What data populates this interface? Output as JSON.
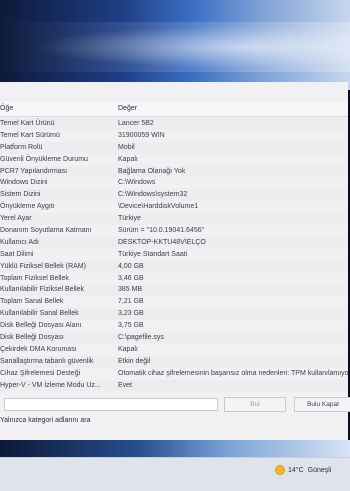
{
  "table": {
    "headers": {
      "item": "Öğe",
      "value": "Değer"
    },
    "rows": [
      {
        "k": "Temel Kart Ürünü",
        "v": "Lancer 5B2"
      },
      {
        "k": "Temel Kart Sürümü",
        "v": "31900059 WIN"
      },
      {
        "k": "Platform Rolü",
        "v": "Mobil"
      },
      {
        "k": "Güvenli Önyükleme Durumu",
        "v": "Kapalı"
      },
      {
        "k": "PCR7 Yapılandırması",
        "v": "Bağlama Olanağı Yok"
      },
      {
        "k": "Windows Dizini",
        "v": "C:\\Windows"
      },
      {
        "k": "Sistem Dizini",
        "v": "C:\\Windows\\system32"
      },
      {
        "k": "Önyükleme Aygıtı",
        "v": "\\Device\\HarddiskVolume1"
      },
      {
        "k": "Yerel Ayar",
        "v": "Türkiye"
      },
      {
        "k": "Donanım Soyutlama Katmanı",
        "v": "Sürüm = \"10.0.19041.6456\""
      },
      {
        "k": "Kullanıcı Adı",
        "v": "DESKTOP-KKTU48V\\ELÇO"
      },
      {
        "k": "Saat Dilimi",
        "v": "Türkiye Standart Saati"
      },
      {
        "k": "Yüklü Fiziksel Bellek (RAM)",
        "v": "4,00 GB"
      },
      {
        "k": "Toplam Fiziksel Bellek",
        "v": "3,46 GB"
      },
      {
        "k": "Kullanılabilir Fiziksel Bellek",
        "v": "385 MB"
      },
      {
        "k": "Toplam Sanal Bellek",
        "v": "7,21 GB"
      },
      {
        "k": "Kullanılabilir Sanal Bellek",
        "v": "3,23 GB"
      },
      {
        "k": "Disk Belleği Dosyası Alanı",
        "v": "3,75 GB"
      },
      {
        "k": "Disk Belleği Dosyası",
        "v": "C:\\pagefile.sys"
      },
      {
        "k": "Çekirdek DMA Koruması",
        "v": "Kapalı"
      },
      {
        "k": "Sanallaştırma tabanlı güvenlik",
        "v": "Etkin değil"
      },
      {
        "k": "Cihaz Şifrelemesi Desteği",
        "v": "Otomatik cihaz şifrelemesinin başarısız olma nedenleri: TPM kullanılamıyor"
      },
      {
        "k": "Hyper-V - VM İzleme Modu Uz...",
        "v": "Evet"
      }
    ]
  },
  "find": {
    "find_label": "Bul",
    "close_label": "Bulu Kapat",
    "status": "Yalnızca kategori adlarını ara"
  },
  "taskbar": {
    "weather_temp": "14°C",
    "weather_text": "Güneşli"
  }
}
